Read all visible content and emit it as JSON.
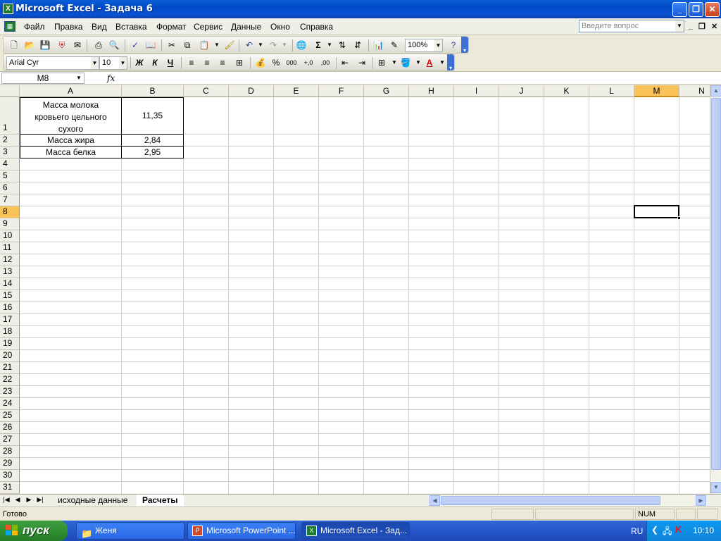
{
  "window": {
    "title": "Microsoft Excel - Задача 6",
    "minimize_label": "_",
    "maximize_label": "❐",
    "close_label": "✕"
  },
  "menu": {
    "items": [
      "Файл",
      "Правка",
      "Вид",
      "Вставка",
      "Формат",
      "Сервис",
      "Данные",
      "Окно",
      "Справка"
    ],
    "ask_placeholder": "Введите вопрос"
  },
  "toolbar_standard": {
    "zoom": "100%"
  },
  "toolbar_format": {
    "font_name": "Arial Cyr",
    "font_size": "10",
    "bold_label": "Ж",
    "italic_label": "К",
    "underline_label": "Ч",
    "percent_label": "%",
    "thousands_label": "000"
  },
  "formula_bar": {
    "name_box": "M8",
    "fx_label": "fx",
    "formula": ""
  },
  "sheet": {
    "columns": [
      "A",
      "B",
      "C",
      "D",
      "E",
      "F",
      "G",
      "H",
      "I",
      "J",
      "K",
      "L",
      "M",
      "N"
    ],
    "rows": [
      "1",
      "2",
      "3",
      "4",
      "5",
      "6",
      "7",
      "8",
      "9",
      "10",
      "11",
      "12",
      "13",
      "14",
      "15",
      "16",
      "17",
      "18",
      "19",
      "20",
      "21",
      "22",
      "23",
      "24",
      "25",
      "26",
      "27",
      "28",
      "29",
      "30",
      "31"
    ],
    "active_column": "M",
    "active_row": "8",
    "cells": {
      "A1": "Масса молока кровьего цельного сухого",
      "B1": "11,35",
      "A2": "Масса жира",
      "B2": "2,84",
      "A3": "Масса белка",
      "B3": "2,95"
    }
  },
  "tabs": {
    "items": [
      "исходные данные",
      "Расчеты"
    ],
    "active": "Расчеты"
  },
  "status": {
    "text": "Готово",
    "num": "NUM"
  },
  "taskbar": {
    "start_label": "пуск",
    "buttons": [
      "Женя",
      "Microsoft PowerPoint ...",
      "Microsoft Excel - Зад..."
    ],
    "lang": "RU",
    "clock": "10:10"
  },
  "colors": {
    "titlebar": "#0a52d4",
    "active_header": "#f9c35a",
    "taskbar": "#2456c8",
    "start_button": "#2e8b2e"
  }
}
